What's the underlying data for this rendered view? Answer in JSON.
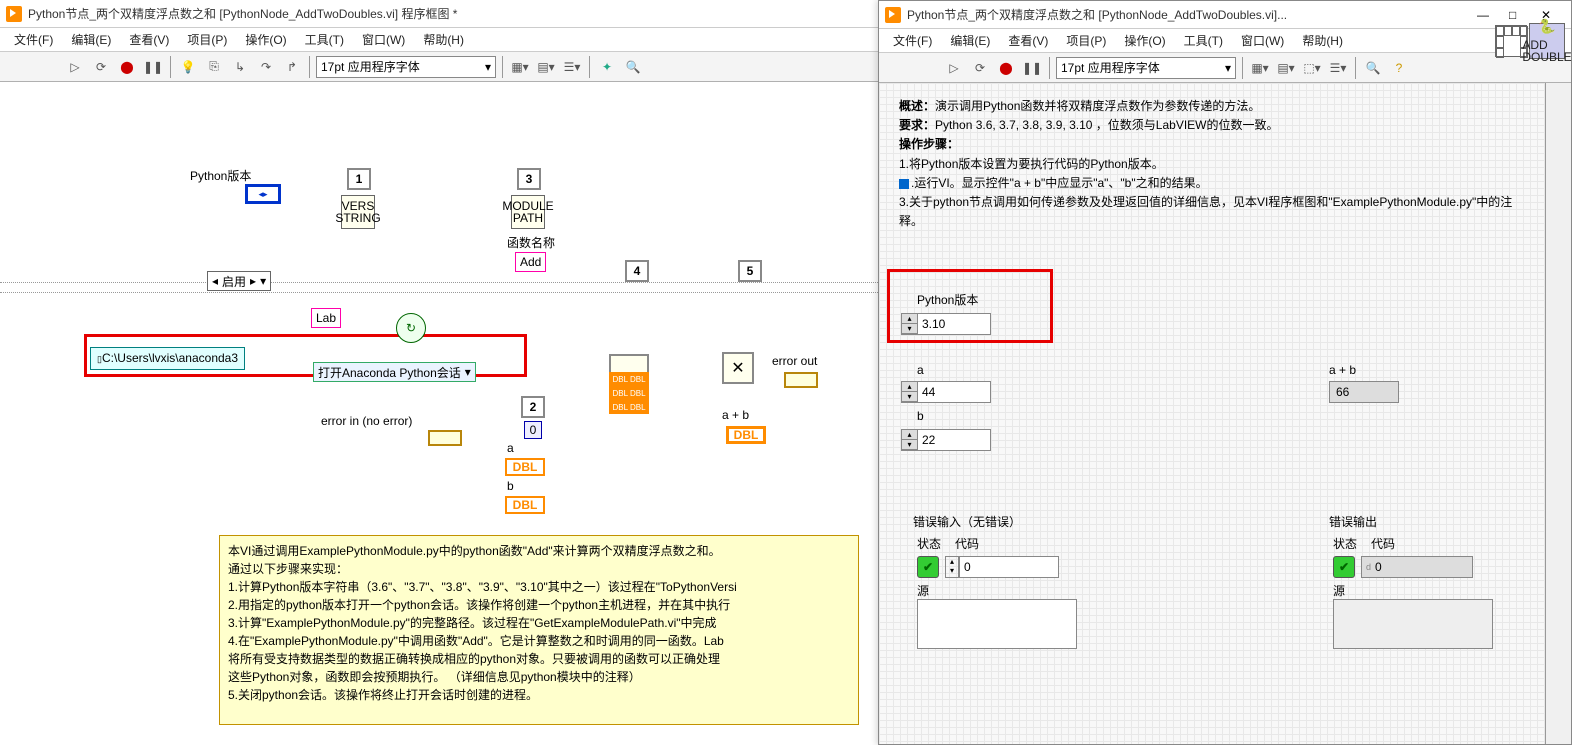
{
  "bd": {
    "title": "Python节点_两个双精度浮点数之和 [PythonNode_AddTwoDoubles.vi] 程序框图 *",
    "menu": [
      "文件(F)",
      "编辑(E)",
      "查看(V)",
      "项目(P)",
      "操作(O)",
      "工具(T)",
      "窗口(W)",
      "帮助(H)"
    ],
    "font": "17pt 应用程序字体",
    "python_version_label": "Python版本",
    "enable_label": "启用",
    "lab_label": "Lab",
    "path_value": "C:\\Users\\lvxis\\anaconda3",
    "open_session_label": "打开Anaconda Python会话",
    "error_in_label": "error in (no error)",
    "error_out_label": "error out",
    "func_name_label": "函数名称",
    "func_name_value": "Add",
    "ab_label": "a + b",
    "a_label": "a",
    "b_label": "b",
    "vers_string": "VERS STRING",
    "module_path": "MODULE PATH",
    "zero": "0",
    "dbl": "DBL",
    "seq": [
      "1",
      "2",
      "3",
      "4",
      "5"
    ],
    "help_text": {
      "l1": "本VI通过调用ExamplePythonModule.py中的python函数\"Add\"来计算两个双精度浮点数之和。",
      "l2": "通过以下步骤来实现：",
      "l3": "1.计算Python版本字符串（3.6\"、\"3.7\"、\"3.8\"、\"3.9\"、\"3.10\"其中之一）该过程在\"ToPythonVersi",
      "l4": "2.用指定的python版本打开一个python会话。该操作将创建一个python主机进程，并在其中执行",
      "l5": "3.计算\"ExamplePythonModule.py\"的完整路径。该过程在\"GetExampleModulePath.vi\"中完成",
      "l6": "4.在\"ExamplePythonModule.py\"中调用函数\"Add\"。它是计算整数之和时调用的同一函数。Lab",
      "l7": "将所有受支持数据类型的数据正确转换成相应的python对象。只要被调用的函数可以正确处理",
      "l8": "这些Python对象，函数即会按预期执行。   （详细信息见python模块中的注释）",
      "l9": "5.关闭python会话。该操作将终止打开会话时创建的进程。"
    }
  },
  "fp": {
    "title": "Python节点_两个双精度浮点数之和 [PythonNode_AddTwoDoubles.vi]...",
    "menu": [
      "文件(F)",
      "编辑(E)",
      "查看(V)",
      "项目(P)",
      "操作(O)",
      "工具(T)",
      "窗口(W)",
      "帮助(H)"
    ],
    "font": "17pt 应用程序字体",
    "overview_label": "概述：",
    "overview": "演示调用Python函数并将双精度浮点数作为参数传递的方法。",
    "req_label": "要求：",
    "req": "Python 3.6, 3.7, 3.8, 3.9, 3.10 ，位数须与LabVIEW的位数一致。",
    "steps_label": "操作步骤：",
    "step1": "1.将Python版本设置为要执行代码的Python版本。",
    "step2": "运行VI。显示控件\"a + b\"中应显示\"a\"、\"b\"之和的结果。",
    "step3": "3.关于python节点调用如何传递参数及处理返回值的详细信息，见本VI程序框图和\"ExamplePythonModule.py\"中的注释。",
    "pyver_label": "Python版本",
    "pyver_value": "3.10",
    "a_label": "a",
    "a_value": "44",
    "b_label": "b",
    "b_value": "22",
    "ab_label": "a + b",
    "ab_value": "66",
    "err_in_label": "错误输入（无错误）",
    "err_out_label": "错误输出",
    "status_label": "状态",
    "code_label": "代码",
    "code_value": "0",
    "source_label": "源",
    "add_icon": "ADD DOUBLE"
  }
}
